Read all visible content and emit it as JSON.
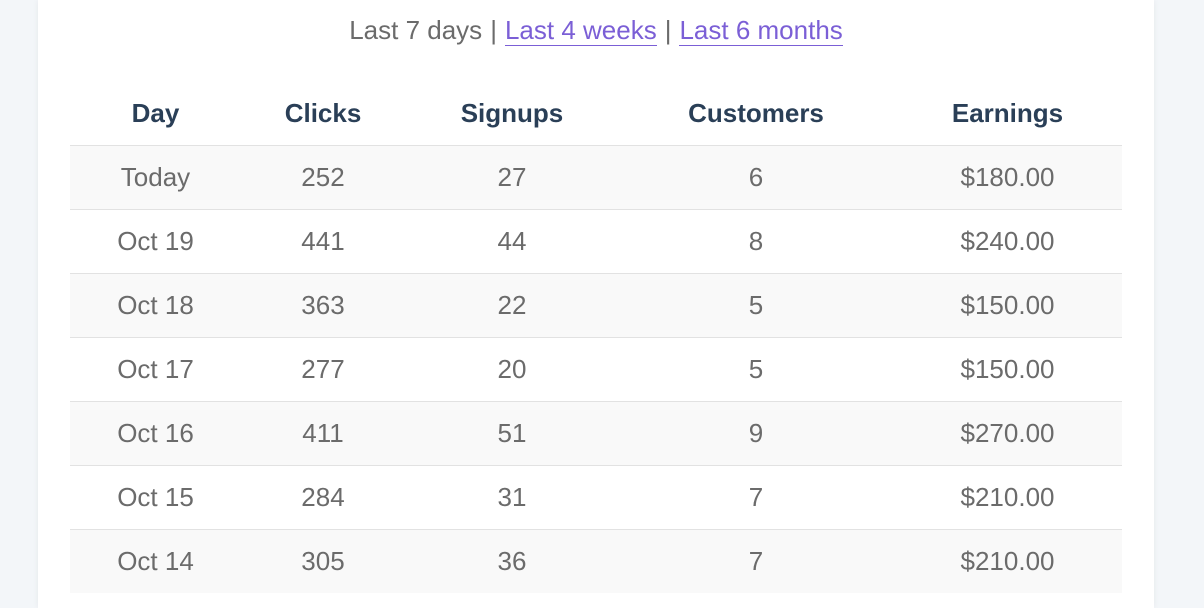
{
  "range_selector": {
    "current": "Last 7 days",
    "separator": "|",
    "links": [
      "Last 4 weeks",
      "Last 6 months"
    ]
  },
  "table": {
    "columns": [
      "Day",
      "Clicks",
      "Signups",
      "Customers",
      "Earnings"
    ],
    "rows": [
      [
        "Today",
        "252",
        "27",
        "6",
        "$180.00"
      ],
      [
        "Oct 19",
        "441",
        "44",
        "8",
        "$240.00"
      ],
      [
        "Oct 18",
        "363",
        "22",
        "5",
        "$150.00"
      ],
      [
        "Oct 17",
        "277",
        "20",
        "5",
        "$150.00"
      ],
      [
        "Oct 16",
        "411",
        "51",
        "9",
        "$270.00"
      ],
      [
        "Oct 15",
        "284",
        "31",
        "7",
        "$210.00"
      ],
      [
        "Oct 14",
        "305",
        "36",
        "7",
        "$210.00"
      ]
    ]
  },
  "colors": {
    "link": "#7b5fd6",
    "header_text": "#2a3f57",
    "body_text": "#6b6b6b",
    "stripe": "#f9f9f9"
  }
}
